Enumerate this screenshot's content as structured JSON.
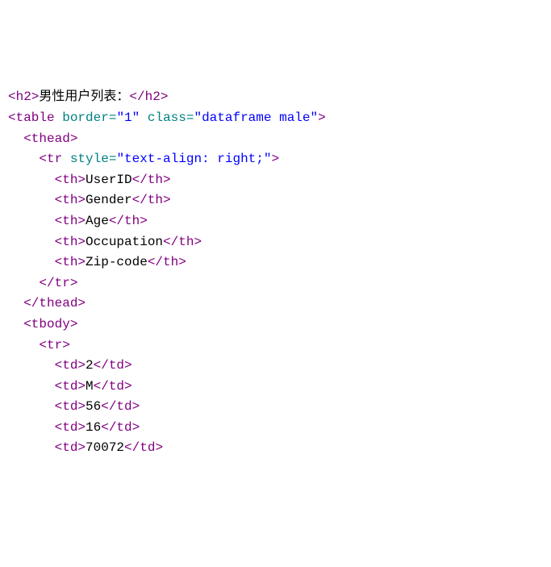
{
  "lines": [
    {
      "indent": 0,
      "parts": [
        {
          "cls": "tag",
          "t": "<h2>"
        },
        {
          "cls": "txt",
          "t": "男性用户列表："
        },
        {
          "cls": "tag",
          "t": "</h2>"
        }
      ]
    },
    {
      "indent": 0,
      "parts": [
        {
          "cls": "tag",
          "t": "<table"
        },
        {
          "cls": "txt",
          "t": " "
        },
        {
          "cls": "attr",
          "t": "border="
        },
        {
          "cls": "val",
          "t": "\"1\""
        },
        {
          "cls": "txt",
          "t": " "
        },
        {
          "cls": "attr",
          "t": "class="
        },
        {
          "cls": "val",
          "t": "\"dataframe male\""
        },
        {
          "cls": "tag",
          "t": ">"
        }
      ]
    },
    {
      "indent": 1,
      "parts": [
        {
          "cls": "tag",
          "t": "<thead>"
        }
      ]
    },
    {
      "indent": 2,
      "parts": [
        {
          "cls": "tag",
          "t": "<tr"
        },
        {
          "cls": "txt",
          "t": " "
        },
        {
          "cls": "attr",
          "t": "style="
        },
        {
          "cls": "val",
          "t": "\"text-align: right;\""
        },
        {
          "cls": "tag",
          "t": ">"
        }
      ]
    },
    {
      "indent": 3,
      "parts": [
        {
          "cls": "tag",
          "t": "<th>"
        },
        {
          "cls": "txt",
          "t": "UserID"
        },
        {
          "cls": "tag",
          "t": "</th>"
        }
      ]
    },
    {
      "indent": 3,
      "parts": [
        {
          "cls": "tag",
          "t": "<th>"
        },
        {
          "cls": "txt",
          "t": "Gender"
        },
        {
          "cls": "tag",
          "t": "</th>"
        }
      ]
    },
    {
      "indent": 3,
      "parts": [
        {
          "cls": "tag",
          "t": "<th>"
        },
        {
          "cls": "txt",
          "t": "Age"
        },
        {
          "cls": "tag",
          "t": "</th>"
        }
      ]
    },
    {
      "indent": 3,
      "parts": [
        {
          "cls": "tag",
          "t": "<th>"
        },
        {
          "cls": "txt",
          "t": "Occupation"
        },
        {
          "cls": "tag",
          "t": "</th>"
        }
      ]
    },
    {
      "indent": 3,
      "parts": [
        {
          "cls": "tag",
          "t": "<th>"
        },
        {
          "cls": "txt",
          "t": "Zip-code"
        },
        {
          "cls": "tag",
          "t": "</th>"
        }
      ]
    },
    {
      "indent": 2,
      "parts": [
        {
          "cls": "tag",
          "t": "</tr>"
        }
      ]
    },
    {
      "indent": 1,
      "parts": [
        {
          "cls": "tag",
          "t": "</thead>"
        }
      ]
    },
    {
      "indent": 1,
      "parts": [
        {
          "cls": "tag",
          "t": "<tbody>"
        }
      ]
    },
    {
      "indent": 2,
      "parts": [
        {
          "cls": "tag",
          "t": "<tr>"
        }
      ]
    },
    {
      "indent": 3,
      "parts": [
        {
          "cls": "tag",
          "t": "<td>"
        },
        {
          "cls": "txt",
          "t": "2"
        },
        {
          "cls": "tag",
          "t": "</td>"
        }
      ]
    },
    {
      "indent": 3,
      "parts": [
        {
          "cls": "tag",
          "t": "<td>"
        },
        {
          "cls": "txt",
          "t": "M"
        },
        {
          "cls": "tag",
          "t": "</td>"
        }
      ]
    },
    {
      "indent": 3,
      "parts": [
        {
          "cls": "tag",
          "t": "<td>"
        },
        {
          "cls": "txt",
          "t": "56"
        },
        {
          "cls": "tag",
          "t": "</td>"
        }
      ]
    },
    {
      "indent": 3,
      "parts": [
        {
          "cls": "tag",
          "t": "<td>"
        },
        {
          "cls": "txt",
          "t": "16"
        },
        {
          "cls": "tag",
          "t": "</td>"
        }
      ]
    },
    {
      "indent": 3,
      "parts": [
        {
          "cls": "tag",
          "t": "<td>"
        },
        {
          "cls": "txt",
          "t": "70072"
        },
        {
          "cls": "tag",
          "t": "</td>"
        }
      ]
    }
  ],
  "indent_unit": "  "
}
